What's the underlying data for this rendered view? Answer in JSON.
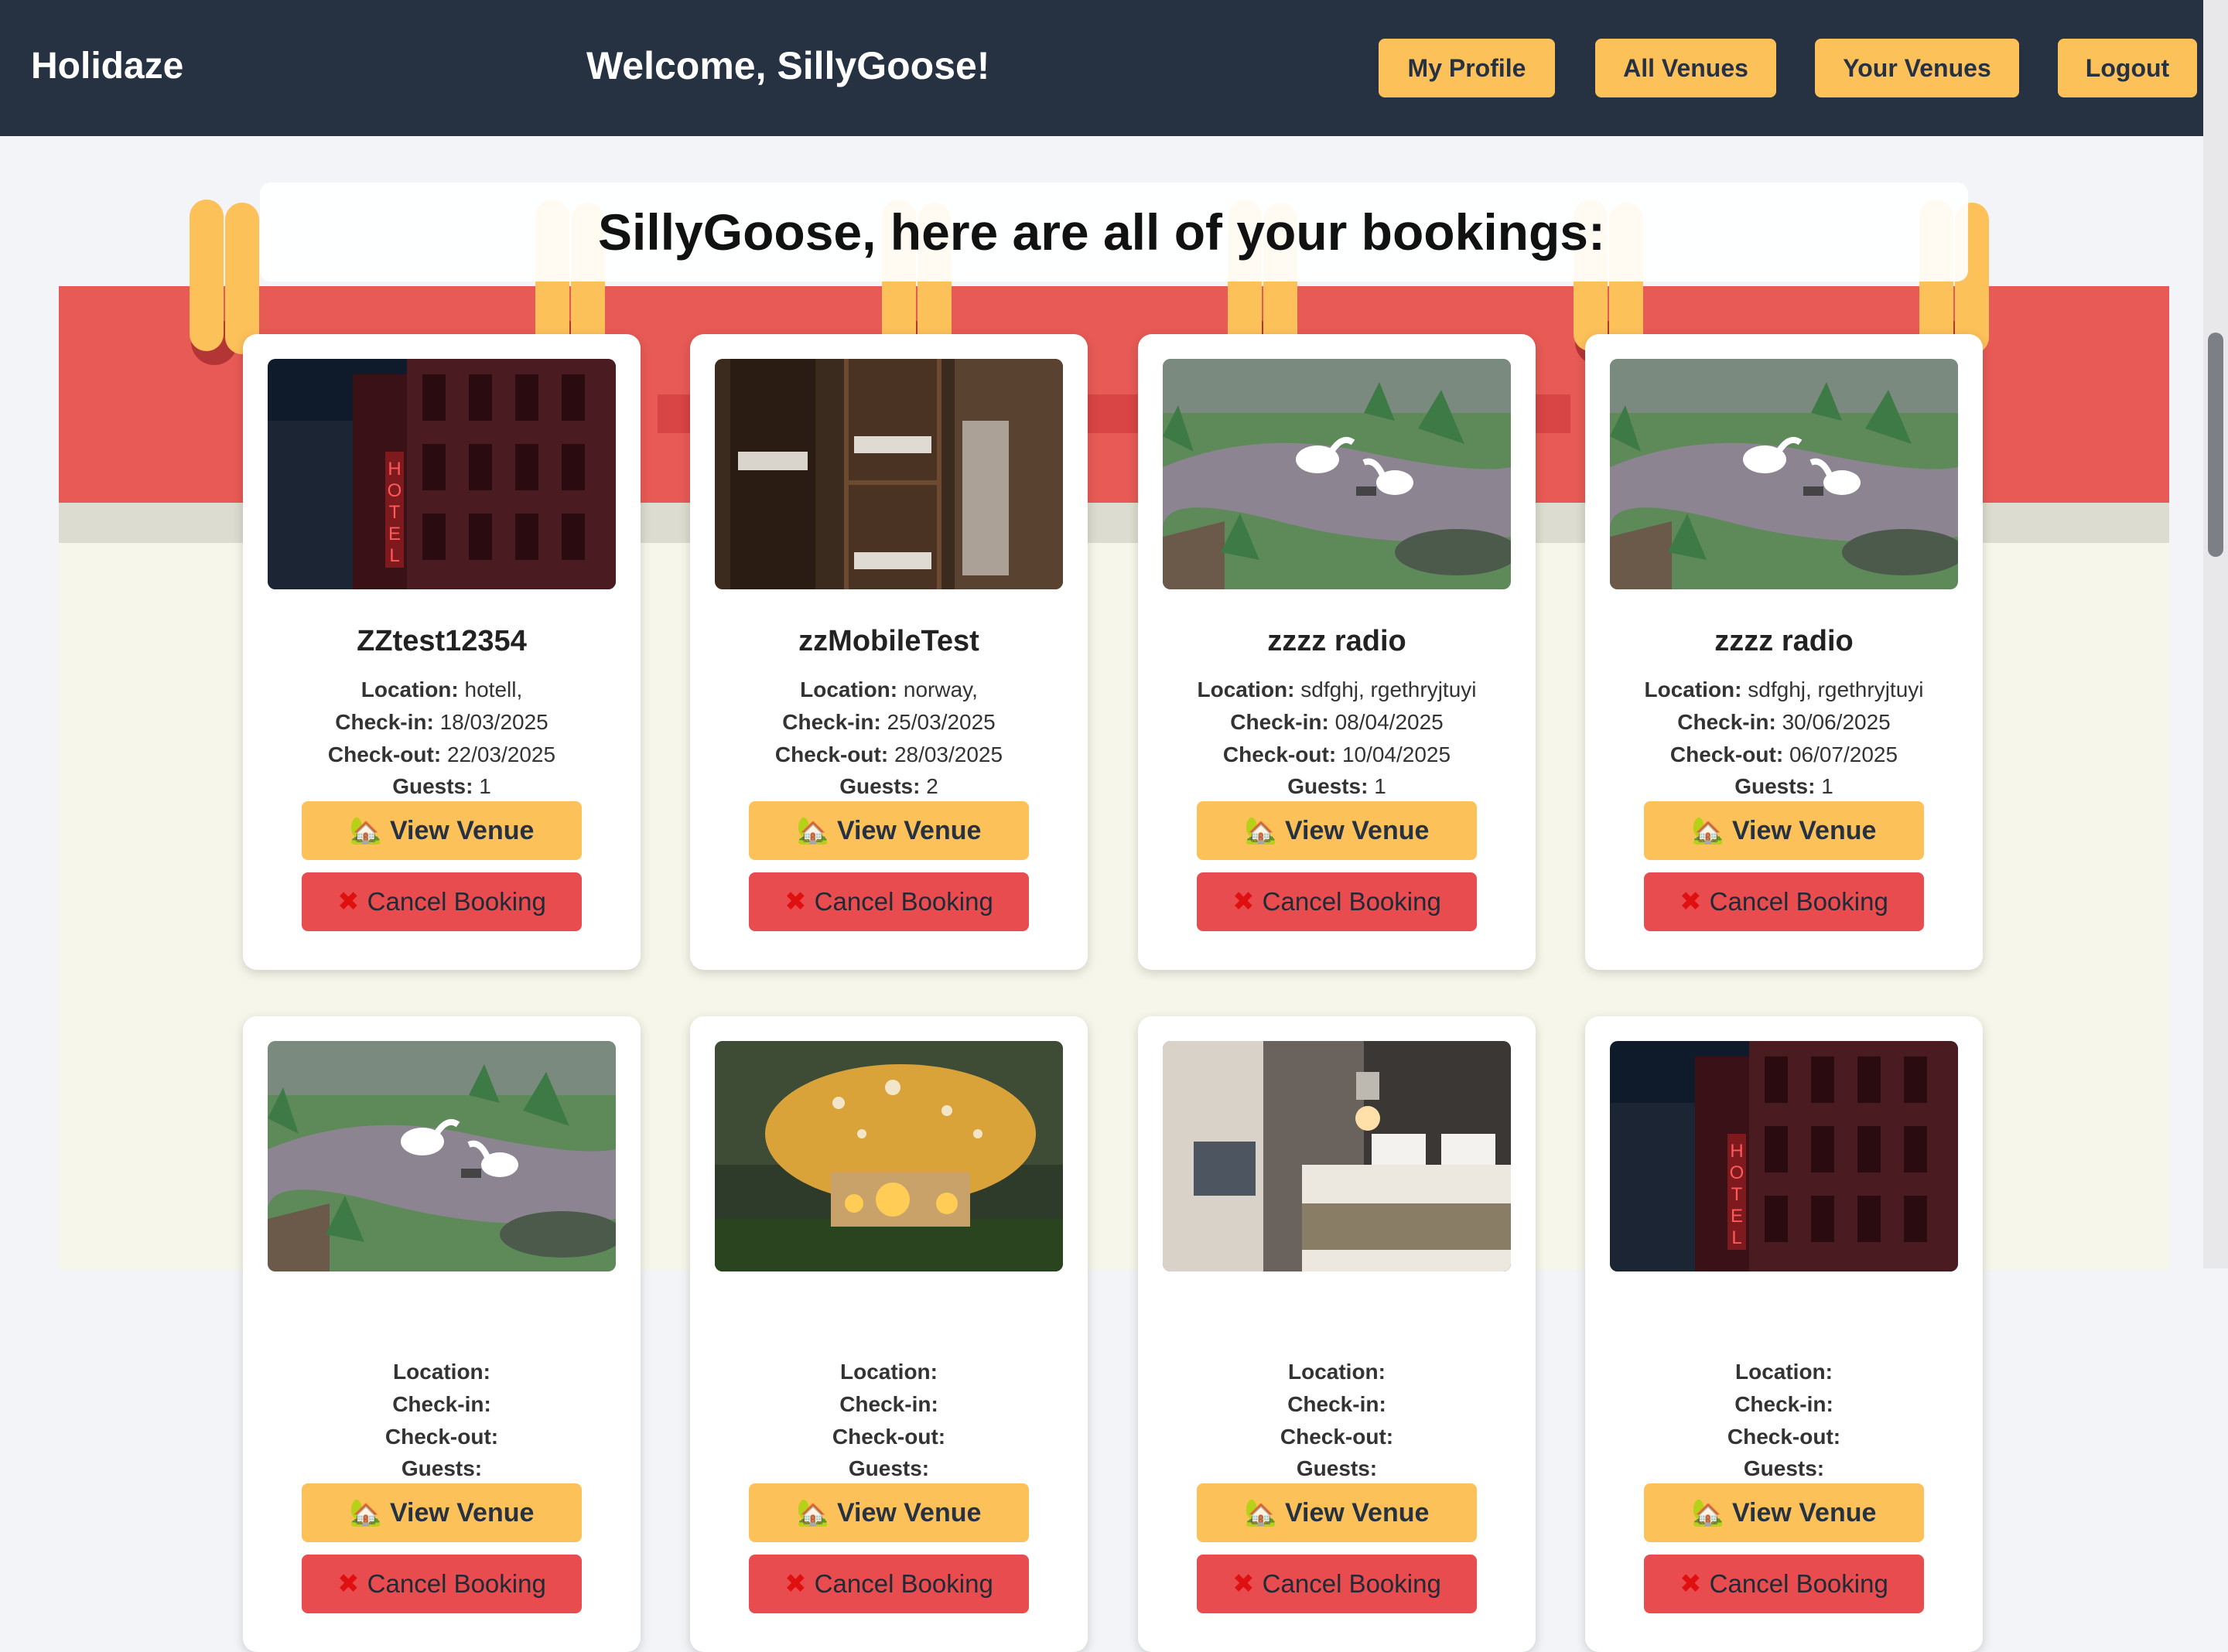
{
  "header": {
    "brand": "Holidaze",
    "welcome": "Welcome, SillyGoose!",
    "nav": [
      "My Profile",
      "All Venues",
      "Your Venues",
      "Logout"
    ]
  },
  "page": {
    "title": "SillyGoose, here are all of your bookings:"
  },
  "labels": {
    "location": "Location:",
    "checkin": "Check-in:",
    "checkout": "Check-out:",
    "guests": "Guests:",
    "view_venue": "View Venue",
    "cancel_booking": "Cancel Booking"
  },
  "bookings": [
    {
      "name": "ZZtest12354",
      "location": "hotell,",
      "checkin": "18/03/2025",
      "checkout": "22/03/2025",
      "guests": "1",
      "image": "hotel-neon"
    },
    {
      "name": "zzMobileTest",
      "location": "norway,",
      "checkin": "25/03/2025",
      "checkout": "28/03/2025",
      "guests": "2",
      "image": "bunk-room"
    },
    {
      "name": "zzzz radio",
      "location": "sdfghj, rgethryjtuyi",
      "checkin": "08/04/2025",
      "checkout": "10/04/2025",
      "guests": "1",
      "image": "geese-garden"
    },
    {
      "name": "zzzz radio",
      "location": "sdfghj, rgethryjtuyi",
      "checkin": "30/06/2025",
      "checkout": "06/07/2025",
      "guests": "1",
      "image": "geese-garden"
    },
    {
      "image": "geese-garden"
    },
    {
      "image": "mushroom-house"
    },
    {
      "image": "hotel-bedroom"
    },
    {
      "image": "hotel-neon"
    }
  ],
  "icons": {
    "view": "house-icon",
    "cancel": "cross-mark-icon"
  },
  "colors": {
    "header_bg": "#263241",
    "accent": "#fdc15a",
    "cancel": "#e84c4f",
    "calendar_red": "#e85a55"
  }
}
